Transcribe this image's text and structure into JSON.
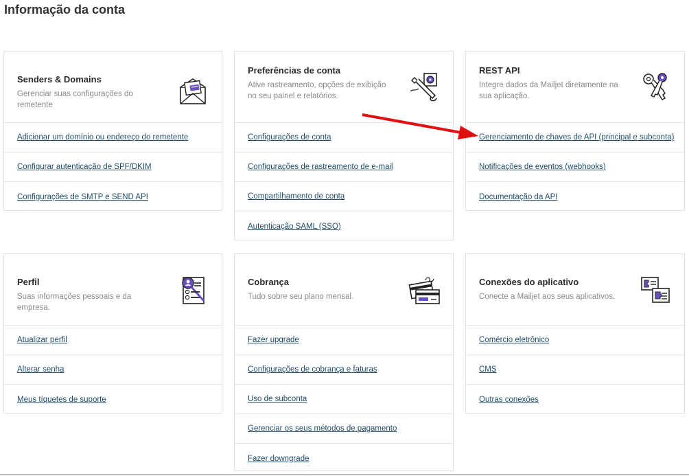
{
  "page": {
    "title": "Informação da conta"
  },
  "colors": {
    "link": "#1f4e6b",
    "accent_purple": "#6a4fc3",
    "annotation_arrow": "#e01010"
  },
  "cards": {
    "senders": {
      "title": "Senders & Domains",
      "desc": "Gerenciar suas configurações do remetente",
      "icon": "envelope-icon",
      "links": [
        "Adicionar um domínio ou endereço do remetente",
        "Configurar autenticação de SPF/DKIM",
        "Configurações de SMTP e SEND API"
      ]
    },
    "preferences": {
      "title": "Preferências de conta",
      "desc": "Ative rastreamento, opções de exibição no seu painel e relatórios.",
      "icon": "wrench-gear-icon",
      "links": [
        "Configurações de conta",
        "Configurações de rastreamento de e-mail",
        "Compartilhamento de conta",
        "Autenticação SAML (SSO)"
      ]
    },
    "restapi": {
      "title": "REST API",
      "desc": "Integre dados da Mailjet diretamente na sua aplicação.",
      "icon": "keys-icon",
      "links": [
        "Gerenciamento de chaves de API (principal e subconta)",
        "Notificações de eventos (webhooks)",
        "Documentação da API"
      ]
    },
    "profile": {
      "title": "Perfil",
      "desc": "Suas informações pessoais e da empresa.",
      "icon": "profile-magnifier-icon",
      "links": [
        "Atualizar perfil",
        "Alterar senha",
        "Meus tíquetes de suporte"
      ]
    },
    "billing": {
      "title": "Cobrança",
      "desc": "Tudo sobre seu plano mensal.",
      "icon": "credit-card-icon",
      "links": [
        "Fazer upgrade",
        "Configurações de cobrança e faturas",
        "Uso de subconta",
        "Gerenciar os seus métodos de pagamento",
        "Fazer downgrade"
      ]
    },
    "connections": {
      "title": "Conexões do aplicativo",
      "desc": "Conecte a Mailjet aos seus aplicativos.",
      "icon": "puzzle-cards-icon",
      "links": [
        "Comércio eletrônico",
        "CMS",
        "Outras conexões"
      ]
    }
  }
}
